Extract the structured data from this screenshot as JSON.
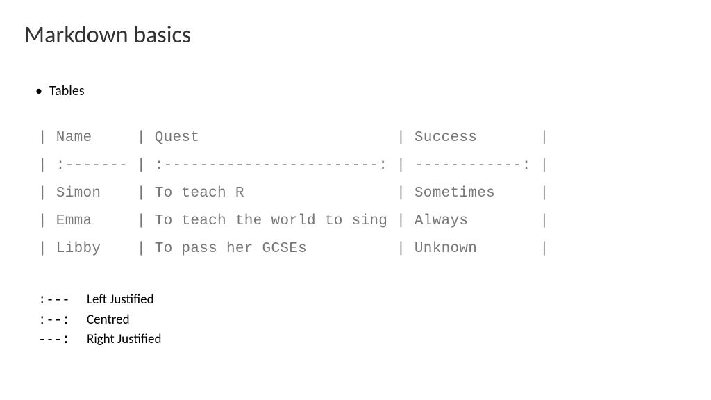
{
  "title": "Markdown basics",
  "bullet": "Tables",
  "table": {
    "line1": "| Name     | Quest                      | Success       |",
    "line2": "| :------- | :------------------------: | ------------: |",
    "line3": "| Simon    | To teach R                 | Sometimes     |",
    "line4": "| Emma     | To teach the world to sing | Always        |",
    "line5": "| Libby    | To pass her GCSEs          | Unknown       |"
  },
  "legend": {
    "r1": {
      "sym": ":---",
      "label": "Left Justified"
    },
    "r2": {
      "sym": ":--:",
      "label": "Centred"
    },
    "r3": {
      "sym": "---:",
      "label": "Right Justified"
    }
  }
}
